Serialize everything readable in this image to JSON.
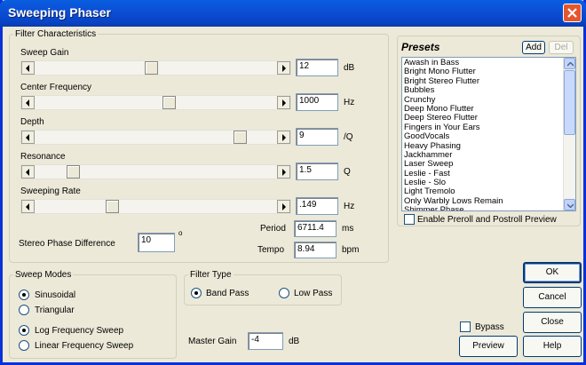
{
  "window": {
    "title": "Sweeping Phaser"
  },
  "filter": {
    "legend": "Filter Characteristics",
    "controls": [
      {
        "label": "Sweep Gain",
        "value": "12",
        "unit": "dB",
        "level": 0.48
      },
      {
        "label": "Center Frequency",
        "value": "1000",
        "unit": "Hz",
        "level": 0.56
      },
      {
        "label": "Depth",
        "value": "9",
        "unit": "/Q",
        "level": 0.87
      },
      {
        "label": "Resonance",
        "value": "1.5",
        "unit": "Q",
        "level": 0.14
      },
      {
        "label": "Sweeping Rate",
        "value": ".149",
        "unit": "Hz",
        "level": 0.31
      }
    ],
    "period_label": "Period",
    "period_value": "6711.4",
    "period_unit": "ms",
    "tempo_label": "Tempo",
    "tempo_value": "8.94",
    "tempo_unit": "bpm",
    "stereo_label": "Stereo Phase Difference",
    "stereo_value": "10",
    "stereo_unit": "o"
  },
  "presets": {
    "title": "Presets",
    "add_label": "Add",
    "del_label": "Del",
    "items": [
      "Awash in Bass",
      "Bright Mono Flutter",
      "Bright Stereo Flutter",
      "Bubbles",
      "Crunchy",
      "Deep Mono Flutter",
      "Deep Stereo Flutter",
      "Fingers in Your Ears",
      "GoodVocals",
      "Heavy Phasing",
      "Jackhammer",
      "Laser Sweep",
      "Leslie - Fast",
      "Leslie - Slo",
      "Light Tremolo",
      "Only Warbly Lows Remain",
      "Shimmer Phase"
    ],
    "preroll_label": "Enable Preroll and Postroll Preview"
  },
  "sweep_modes": {
    "legend": "Sweep Modes",
    "sinusoidal": "Sinusoidal",
    "triangular": "Triangular",
    "log": "Log Frequency Sweep",
    "linear": "Linear Frequency Sweep"
  },
  "filter_type": {
    "legend": "Filter Type",
    "band_pass": "Band Pass",
    "low_pass": "Low Pass"
  },
  "master_gain": {
    "label": "Master Gain",
    "value": "-4",
    "unit": "dB"
  },
  "buttons": {
    "ok": "OK",
    "cancel": "Cancel",
    "close": "Close",
    "preview": "Preview",
    "help": "Help",
    "bypass": "Bypass"
  }
}
